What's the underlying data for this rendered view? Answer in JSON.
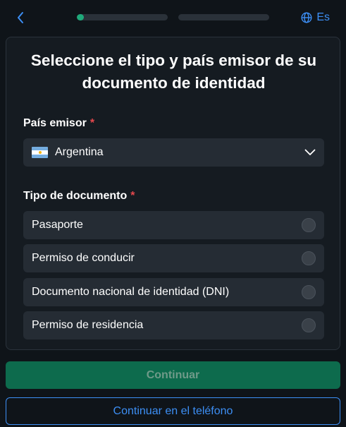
{
  "header": {
    "lang_label": "Es",
    "steps": [
      {
        "progress": 0.08
      },
      {
        "progress": 0
      }
    ]
  },
  "card": {
    "title": "Seleccione el tipo y país emisor de su documento de identidad",
    "country_label": "País emisor",
    "required_mark": "*",
    "country_value": "Argentina",
    "country_flag": "argentina-flag",
    "doc_type_label": "Tipo de documento",
    "doc_options": [
      {
        "label": "Pasaporte"
      },
      {
        "label": "Permiso de conducir"
      },
      {
        "label": "Documento nacional de identidad (DNI)"
      },
      {
        "label": "Permiso de residencia"
      }
    ]
  },
  "actions": {
    "continue_label": "Continuar",
    "continue_phone_label": "Continuar en el teléfono"
  },
  "colors": {
    "background": "#0f1419",
    "accent": "#3d8ff5",
    "progress": "#1fa97a",
    "required": "#e5484d",
    "primary_button": "#0d6b4d"
  }
}
